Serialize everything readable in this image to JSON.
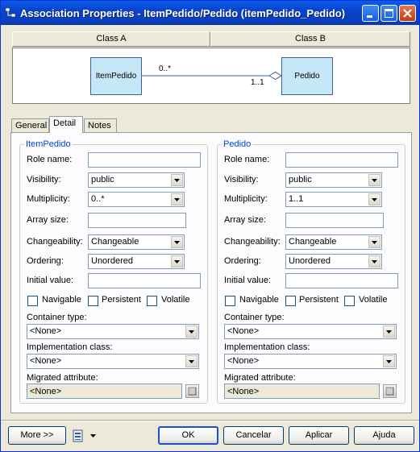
{
  "window": {
    "title": "Association Properties - ItemPedido/Pedido (itemPedido_Pedido)",
    "controls": [
      "minimize-icon",
      "maximize-icon",
      "close-icon"
    ]
  },
  "header": {
    "class_a": "Class A",
    "class_b": "Class B"
  },
  "diagram": {
    "class_a_name": "ItemPedido",
    "class_b_name": "Pedido",
    "mult_a": "0..*",
    "mult_b": "1..1"
  },
  "tabs": [
    {
      "label": "General",
      "active": false
    },
    {
      "label": "Detail",
      "active": true
    },
    {
      "label": "Notes",
      "active": false
    }
  ],
  "left": {
    "group_title": "ItemPedido",
    "role_name_label": "Role name:",
    "role_name_value": "",
    "visibility_label": "Visibility:",
    "visibility_value": "public",
    "multiplicity_label": "Multiplicity:",
    "multiplicity_value": "0..*",
    "array_size_label": "Array size:",
    "array_size_value": "",
    "changeability_label": "Changeability:",
    "changeability_value": "Changeable",
    "ordering_label": "Ordering:",
    "ordering_value": "Unordered",
    "initial_value_label": "Initial value:",
    "initial_value_value": "",
    "navigable_label": "Navigable",
    "persistent_label": "Persistent",
    "volatile_label": "Volatile",
    "container_type_label": "Container type:",
    "container_type_value": "<None>",
    "impl_class_label": "Implementation class:",
    "impl_class_value": "<None>",
    "migrated_label": "Migrated attribute:",
    "migrated_value": "<None>"
  },
  "right": {
    "group_title": "Pedido",
    "role_name_label": "Role name:",
    "role_name_value": "",
    "visibility_label": "Visibility:",
    "visibility_value": "public",
    "multiplicity_label": "Multiplicity:",
    "multiplicity_value": "1..1",
    "array_size_label": "Array size:",
    "array_size_value": "",
    "changeability_label": "Changeability:",
    "changeability_value": "Changeable",
    "ordering_label": "Ordering:",
    "ordering_value": "Unordered",
    "initial_value_label": "Initial value:",
    "initial_value_value": "",
    "navigable_label": "Navigable",
    "persistent_label": "Persistent",
    "volatile_label": "Volatile",
    "container_type_label": "Container type:",
    "container_type_value": "<None>",
    "impl_class_label": "Implementation class:",
    "impl_class_value": "<None>",
    "migrated_label": "Migrated attribute:",
    "migrated_value": "<None>"
  },
  "footer": {
    "more_label": "More >>",
    "ok_label": "OK",
    "cancel_label": "Cancelar",
    "apply_label": "Aplicar",
    "help_label": "Ajuda"
  },
  "colors": {
    "titlebar": "#0a5ce9",
    "class_fill": "#c6e7f7",
    "group_legend": "#0046d5"
  }
}
